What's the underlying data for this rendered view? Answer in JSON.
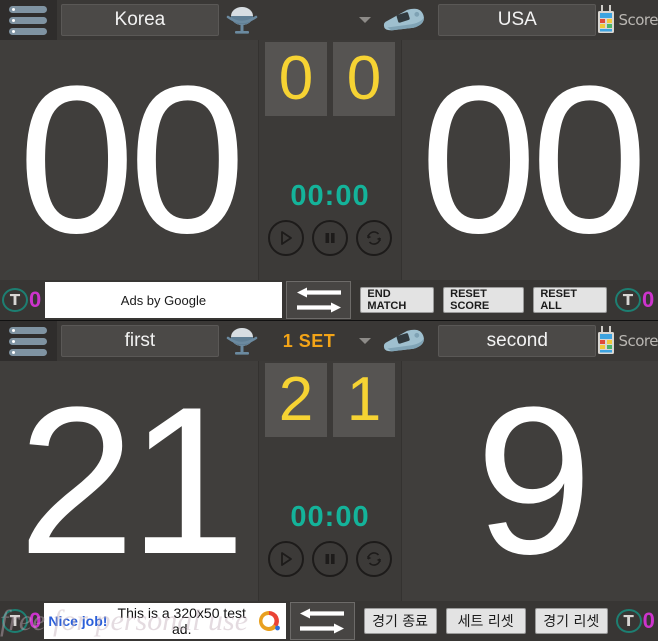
{
  "panels": [
    {
      "menu_icon": "hamburger-icon",
      "team_left": "Korea",
      "team_right": "USA",
      "net_icon": "volleyball-net-icon",
      "whistle_icon": "whistle-icon",
      "set_label": "",
      "score_icon_label": "Score",
      "set_left": "0",
      "set_right": "0",
      "score_left": "00",
      "score_right": "00",
      "timer": "00:00",
      "timeout_left": "0",
      "timeout_right": "0",
      "timeout_letter": "T",
      "ad": {
        "type": "plain",
        "text": "Ads by Google"
      },
      "buttons": {
        "end": "END MATCH",
        "reset_score": "RESET SCORE",
        "reset_all": "RESET ALL"
      }
    },
    {
      "menu_icon": "hamburger-icon",
      "team_left": "first",
      "team_right": "second",
      "net_icon": "volleyball-net-icon",
      "whistle_icon": "whistle-icon",
      "set_label": "1 SET",
      "score_icon_label": "Score",
      "set_left": "2",
      "set_right": "1",
      "score_left": "21",
      "score_right": "9",
      "timer": "00:00",
      "timeout_left": "0",
      "timeout_right": "0",
      "timeout_letter": "T",
      "ad": {
        "type": "test",
        "nice": "Nice job!",
        "text": "This is a 320x50 test ad."
      },
      "buttons": {
        "end": "경기 종료",
        "reset_score": "세트 리셋",
        "reset_all": "경기 리셋"
      }
    }
  ],
  "watermark": "free for personal use",
  "colors": {
    "set_number": "#f6d333",
    "timer": "#14b39a",
    "set_label": "#f3a417",
    "timeout_count": "#cc33cc",
    "background": "#3e3c3a"
  }
}
